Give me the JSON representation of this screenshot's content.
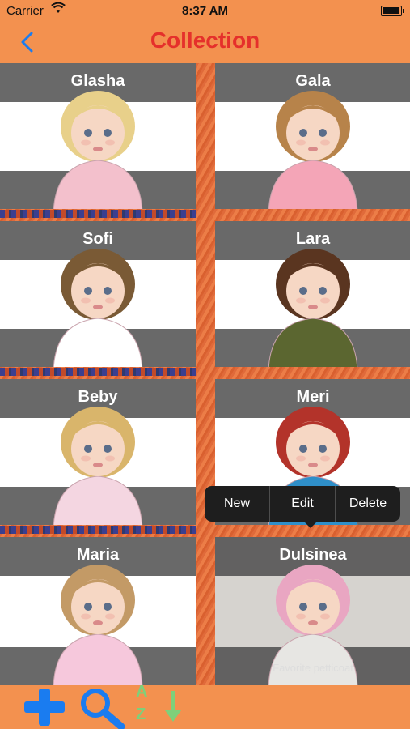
{
  "status_bar": {
    "carrier": "Carrier",
    "time": "8:37 AM"
  },
  "nav": {
    "title": "Collection",
    "back_icon": "chevron-left-icon"
  },
  "dolls": [
    {
      "name": "Glasha",
      "hair": "#e8d08a",
      "dress": "#f3c0cc",
      "bg": "#ffffff"
    },
    {
      "name": "Gala",
      "hair": "#b7834a",
      "dress": "#f4a5b7",
      "bg": "#ffffff"
    },
    {
      "name": "Sofi",
      "hair": "#7a5a35",
      "dress": "#ffffff",
      "bg": "#ffffff"
    },
    {
      "name": "Lara",
      "hair": "#5a3520",
      "dress": "#5b6630",
      "bg": "#ffffff"
    },
    {
      "name": "Beby",
      "hair": "#d9b56b",
      "dress": "#f4d6e1",
      "bg": "#ffffff"
    },
    {
      "name": "Meri",
      "hair": "#b3332a",
      "dress": "#2f8fc9",
      "bg": "#ffffff"
    },
    {
      "name": "Maria",
      "hair": "#c39a66",
      "dress": "#f6c8dc",
      "bg": "#ffffff"
    },
    {
      "name": "Dulsinea",
      "hair": "#e9a6c2",
      "dress": "#e7e6e3",
      "bg": "#d6d3cf",
      "caption": "Favorite petticoat"
    }
  ],
  "context_menu": {
    "items": [
      "New",
      "Edit",
      "Delete"
    ]
  },
  "toolbar": {
    "add_icon": "plus-icon",
    "search_icon": "search-icon",
    "sort_icon": "sort-az-icon",
    "sort_top_letter": "A",
    "sort_bottom_letter": "Z"
  },
  "colors": {
    "accent": "#f3914f",
    "title": "#e5302b",
    "back": "#1a7cf0",
    "toolbar_icon": "#1a7cf0",
    "sort_icon": "#7ed07a"
  }
}
